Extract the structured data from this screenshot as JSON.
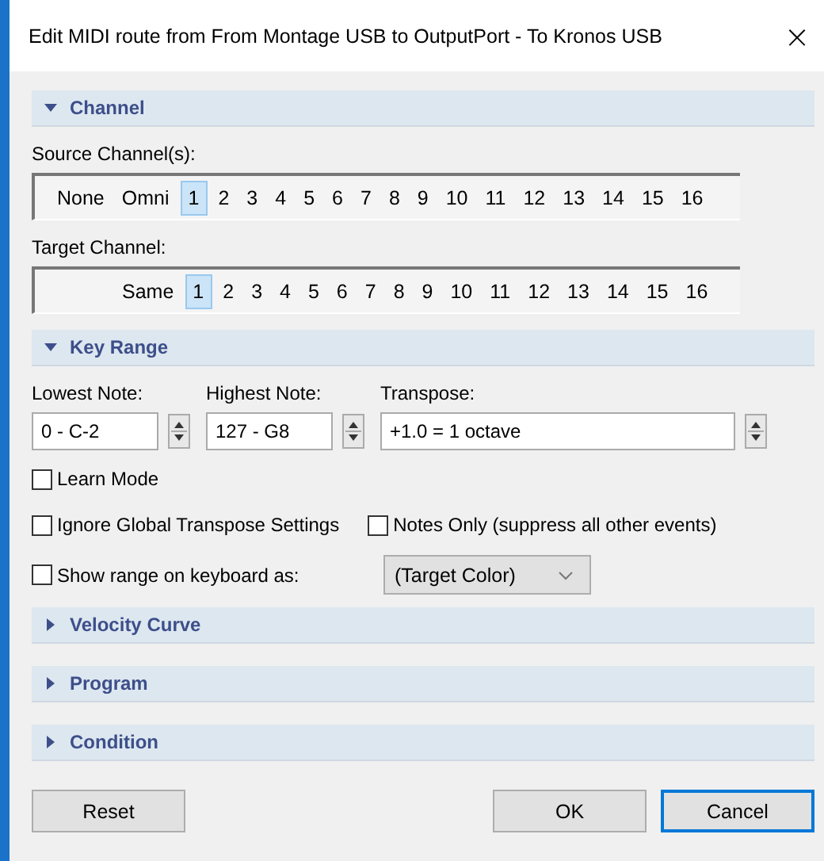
{
  "window": {
    "title": "Edit MIDI route from From Montage USB to OutputPort - To Kronos USB",
    "close": "×"
  },
  "sections": [
    {
      "kind": "channel",
      "title": "Channel",
      "expanded": true,
      "source_label": "Source Channel(s):",
      "source": [
        {
          "label": "None",
          "selected": false
        },
        {
          "label": "Omni",
          "selected": false
        },
        {
          "label": "1",
          "selected": true
        },
        {
          "label": "2",
          "selected": false
        },
        {
          "label": "3",
          "selected": false
        },
        {
          "label": "4",
          "selected": false
        },
        {
          "label": "5",
          "selected": false
        },
        {
          "label": "6",
          "selected": false
        },
        {
          "label": "7",
          "selected": false
        },
        {
          "label": "8",
          "selected": false
        },
        {
          "label": "9",
          "selected": false
        },
        {
          "label": "10",
          "selected": false
        },
        {
          "label": "11",
          "selected": false
        },
        {
          "label": "12",
          "selected": false
        },
        {
          "label": "13",
          "selected": false
        },
        {
          "label": "14",
          "selected": false
        },
        {
          "label": "15",
          "selected": false
        },
        {
          "label": "16",
          "selected": false
        }
      ],
      "target_label": "Target Channel:",
      "target": [
        {
          "label": "Same",
          "selected": false
        },
        {
          "label": "1",
          "selected": true
        },
        {
          "label": "2",
          "selected": false
        },
        {
          "label": "3",
          "selected": false
        },
        {
          "label": "4",
          "selected": false
        },
        {
          "label": "5",
          "selected": false
        },
        {
          "label": "6",
          "selected": false
        },
        {
          "label": "7",
          "selected": false
        },
        {
          "label": "8",
          "selected": false
        },
        {
          "label": "9",
          "selected": false
        },
        {
          "label": "10",
          "selected": false
        },
        {
          "label": "11",
          "selected": false
        },
        {
          "label": "12",
          "selected": false
        },
        {
          "label": "13",
          "selected": false
        },
        {
          "label": "14",
          "selected": false
        },
        {
          "label": "15",
          "selected": false
        },
        {
          "label": "16",
          "selected": false
        }
      ]
    },
    {
      "kind": "key_range",
      "title": "Key Range",
      "expanded": true,
      "spinners": [
        {
          "label": "Lowest Note:",
          "value": "0 - C-2"
        },
        {
          "label": "Highest Note:",
          "value": "127 - G8"
        },
        {
          "label": "Transpose:",
          "value": "+1.0 = 1 octave"
        }
      ],
      "learn_mode": {
        "label": "Learn Mode",
        "checked": false
      },
      "ignore_global": {
        "label": "Ignore Global Transpose Settings",
        "checked": false
      },
      "notes_only": {
        "label": "Notes Only (suppress all other events)",
        "checked": false
      },
      "show_range": {
        "label": "Show range on keyboard as:",
        "checked": false,
        "value": "(Target Color)"
      }
    },
    {
      "title": "Velocity Curve",
      "expanded": false
    },
    {
      "title": "Program",
      "expanded": false
    },
    {
      "title": "Condition",
      "expanded": false
    }
  ],
  "buttons": [
    {
      "label": "Reset",
      "default": false
    },
    {
      "label": "OK",
      "default": false
    },
    {
      "label": "Cancel",
      "default": true
    }
  ]
}
